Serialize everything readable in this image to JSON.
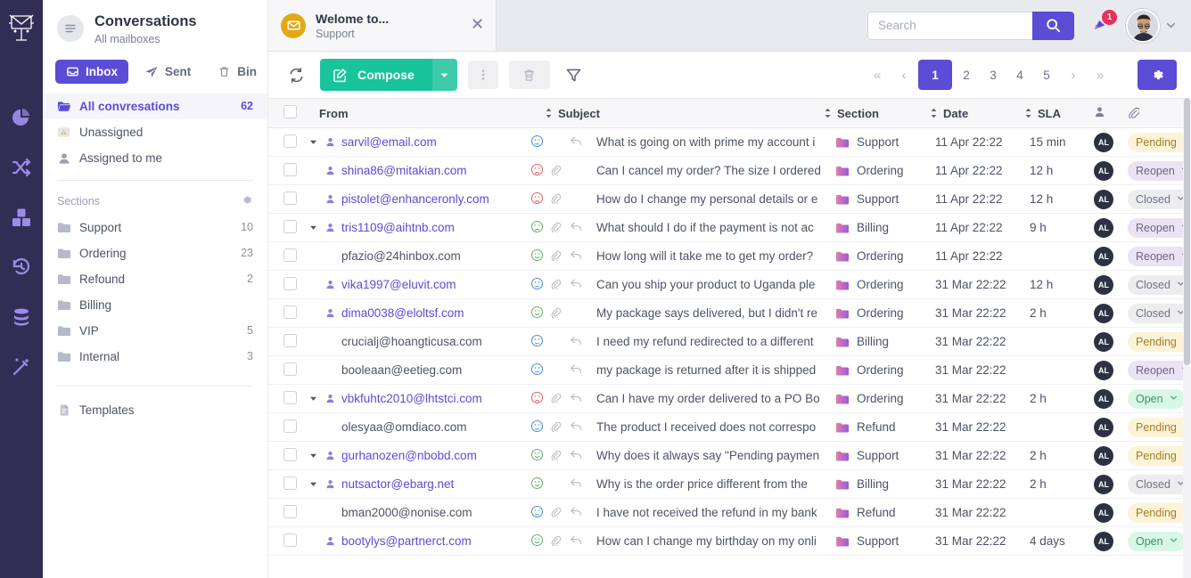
{
  "rail": {
    "logo_icon": "mail-antenna-logo",
    "items": [
      {
        "icon": "pie-chart-icon",
        "name": "rail-item-reports"
      },
      {
        "icon": "shuffle-icon",
        "name": "rail-item-routing"
      },
      {
        "icon": "boxes-icon",
        "name": "rail-item-products"
      },
      {
        "icon": "history-icon",
        "name": "rail-item-history"
      },
      {
        "icon": "database-icon",
        "name": "rail-item-database"
      },
      {
        "icon": "magic-wand-icon",
        "name": "rail-item-automation"
      }
    ]
  },
  "sidebar": {
    "title": "Conversations",
    "subtitle": "All mailboxes",
    "head_icon": "list-lines-icon",
    "tabs": [
      {
        "label": "Inbox",
        "icon": "inbox-icon",
        "active": true
      },
      {
        "label": "Sent",
        "icon": "paper-plane-icon",
        "active": false
      },
      {
        "label": "Bin",
        "icon": "trash-icon",
        "active": false
      }
    ],
    "mailboxes": [
      {
        "label": "All convresations",
        "count": "62",
        "icon": "open-folder-icon",
        "selected": true
      },
      {
        "label": "Unassigned",
        "count": "",
        "icon": "warning-icon",
        "selected": false
      },
      {
        "label": "Assigned to me",
        "count": "",
        "icon": "user-icon",
        "selected": false
      }
    ],
    "sections_header": "Sections",
    "sections_gear_icon": "gear-icon",
    "sections": [
      {
        "label": "Support",
        "count": "10",
        "icon": "folder-icon"
      },
      {
        "label": "Ordering",
        "count": "23",
        "icon": "folder-icon"
      },
      {
        "label": "Refound",
        "count": "2",
        "icon": "folder-icon"
      },
      {
        "label": "Billing",
        "count": "",
        "icon": "folder-icon"
      },
      {
        "label": "VIP",
        "count": "5",
        "icon": "folder-icon"
      },
      {
        "label": "Internal",
        "count": "3",
        "icon": "folder-icon"
      }
    ],
    "templates": {
      "label": "Templates",
      "icon": "document-icon"
    }
  },
  "topbar": {
    "conversation_tab": {
      "title": "Welome to...",
      "subtitle": "Support",
      "avatar_icon": "envelope-icon",
      "close_icon": "close-icon"
    },
    "search": {
      "value": "",
      "placeholder": "Search",
      "button_icon": "search-icon"
    },
    "notifications": {
      "icon": "bell-icon",
      "count": "1"
    },
    "account": {
      "avatar": "user-photo-avatar",
      "caret_icon": "chevron-down-icon"
    }
  },
  "toolbar": {
    "refresh_icon": "refresh-icon",
    "compose_label": "Compose",
    "compose_icon": "pencil-square-icon",
    "compose_caret_icon": "chevron-down-icon",
    "more_icon": "vertical-dots-icon",
    "delete_icon": "trash-icon",
    "filter_icon": "funnel-icon",
    "settings_icon": "gear-icon",
    "pagination": {
      "first_icon": "double-chevron-left-icon",
      "prev_icon": "chevron-left-icon",
      "pages": [
        "1",
        "2",
        "3",
        "4",
        "5"
      ],
      "current": "1",
      "next_icon": "chevron-right-icon",
      "last_icon": "double-chevron-right-icon"
    }
  },
  "table": {
    "columns": [
      {
        "key": "check",
        "label": "",
        "sortable": false
      },
      {
        "key": "from",
        "label": "From",
        "sortable": false
      },
      {
        "key": "subject",
        "label": "Subject",
        "sortable": true
      },
      {
        "key": "section",
        "label": "Section",
        "sortable": true
      },
      {
        "key": "date",
        "label": "Date",
        "sortable": true
      },
      {
        "key": "sla",
        "label": "SLA",
        "sortable": true
      },
      {
        "key": "assignee",
        "label": "",
        "icon": "user-icon",
        "sortable": false
      },
      {
        "key": "attachment",
        "label": "",
        "icon": "paperclip-icon",
        "sortable": false
      }
    ],
    "rows": [
      {
        "expandable": true,
        "has_user": true,
        "from": "sarvil@email.com",
        "mood": "neutral-blue",
        "clip": false,
        "reply": true,
        "subject": "What is going on with prime my account i",
        "section": "Support",
        "date": "11 Apr 22:22",
        "sla": "15 min",
        "assignee": "AL",
        "status": "Pending"
      },
      {
        "expandable": false,
        "has_user": true,
        "from": "shina86@mitakian.com",
        "mood": "sad-red",
        "clip": true,
        "reply": false,
        "subject": "Can I cancel my order? The size I ordered",
        "section": "Ordering",
        "date": "11 Apr 22:22",
        "sla": "12 h",
        "assignee": "AL",
        "status": "Reopen"
      },
      {
        "expandable": false,
        "has_user": true,
        "from": "pistolet@enhanceronly.com",
        "mood": "sad-red",
        "clip": true,
        "reply": false,
        "subject": "How do I change my personal details or e",
        "section": "Support",
        "date": "11 Apr 22:22",
        "sla": "12 h",
        "assignee": "AL",
        "status": "Closed"
      },
      {
        "expandable": true,
        "has_user": true,
        "from": "tris1109@aihtnb.com",
        "mood": "sad-green",
        "clip": true,
        "reply": true,
        "subject": "What should I do if the payment is not ac",
        "section": "Billing",
        "date": "11 Apr 22:22",
        "sla": "9 h",
        "assignee": "AL",
        "status": "Reopen"
      },
      {
        "expandable": false,
        "has_user": false,
        "from": "pfazio@24hinbox.com",
        "mood": "happy-green",
        "clip": true,
        "reply": true,
        "subject": "How long will it take me to get my order?",
        "section": "Ordering",
        "date": "11 Apr 22:22",
        "sla": "",
        "assignee": "AL",
        "status": "Reopen"
      },
      {
        "expandable": false,
        "has_user": true,
        "from": "vika1997@eluvit.com",
        "mood": "neutral-blue",
        "clip": true,
        "reply": true,
        "subject": "Can you ship your product to Uganda ple",
        "section": "Ordering",
        "date": "31 Mar 22:22",
        "sla": "12 h",
        "assignee": "AL",
        "status": "Closed"
      },
      {
        "expandable": false,
        "has_user": true,
        "from": "dima0038@eloltsf.com",
        "mood": "happy-green",
        "clip": true,
        "reply": false,
        "subject": "My package says delivered, but I didn't re",
        "section": "Ordering",
        "date": "31 Mar 22:22",
        "sla": "2 h",
        "assignee": "AL",
        "status": "Closed"
      },
      {
        "expandable": false,
        "has_user": false,
        "from": "crucialj@hoangticusa.com",
        "mood": "neutral-blue",
        "clip": false,
        "reply": true,
        "subject": "I need my refund redirected to a different",
        "section": "Billing",
        "date": "31 Mar 22:22",
        "sla": "",
        "assignee": "AL",
        "status": "Pending"
      },
      {
        "expandable": false,
        "has_user": false,
        "from": "booleaan@eetieg.com",
        "mood": "neutral-blue",
        "clip": false,
        "reply": true,
        "subject": " my package is returned after it is shipped",
        "section": "Ordering",
        "date": "31 Mar 22:22",
        "sla": "",
        "assignee": "AL",
        "status": "Reopen"
      },
      {
        "expandable": true,
        "has_user": true,
        "from": "vbkfuhtc2010@lhtstci.com",
        "mood": "sad-red",
        "clip": true,
        "reply": true,
        "subject": "Can I have my order delivered to a PO Bo",
        "section": "Ordering",
        "date": "31 Mar 22:22",
        "sla": "2 h",
        "assignee": "AL",
        "status": "Open"
      },
      {
        "expandable": false,
        "has_user": false,
        "from": "olesyaa@omdiaco.com",
        "mood": "neutral-blue",
        "clip": true,
        "reply": true,
        "subject": "The product I received does not correspo",
        "section": "Refund",
        "date": "31 Mar 22:22",
        "sla": "",
        "assignee": "AL",
        "status": "Pending"
      },
      {
        "expandable": true,
        "has_user": true,
        "from": "gurhanozen@nbobd.com",
        "mood": "happy-green",
        "clip": true,
        "reply": true,
        "subject": "Why does it always say \"Pending paymen",
        "section": "Support",
        "date": "31 Mar 22:22",
        "sla": "2 h",
        "assignee": "AL",
        "status": "Pending"
      },
      {
        "expandable": true,
        "has_user": true,
        "from": "nutsactor@ebarg.net",
        "mood": "happy-green",
        "clip": false,
        "reply": true,
        "subject": "Why is the order price different from the ",
        "section": "Billing",
        "date": "31 Mar 22:22",
        "sla": "2 h",
        "assignee": "AL",
        "status": "Closed"
      },
      {
        "expandable": false,
        "has_user": false,
        "from": "bman2000@nonise.com",
        "mood": "neutral-blue",
        "clip": true,
        "reply": true,
        "subject": "I have not received the refund in my bank",
        "section": "Refund",
        "date": "31 Mar 22:22",
        "sla": "",
        "assignee": "AL",
        "status": "Pending"
      },
      {
        "expandable": false,
        "has_user": true,
        "from": "bootylys@partnerct.com",
        "mood": "happy-green",
        "clip": true,
        "reply": true,
        "subject": "How can I change my birthday on my onli",
        "section": "Support",
        "date": "31 Mar 22:22",
        "sla": "4 days",
        "assignee": "AL",
        "status": "Open"
      }
    ]
  },
  "colors": {
    "brand_purple": "#5b4cd6",
    "rail_dark": "#322d55",
    "compose_green": "#19c39c",
    "badge_pending": "#fdf3d8",
    "badge_open": "#d9f7e6",
    "notification_red": "#e8305a",
    "folder_pink": "#d77ac0"
  }
}
